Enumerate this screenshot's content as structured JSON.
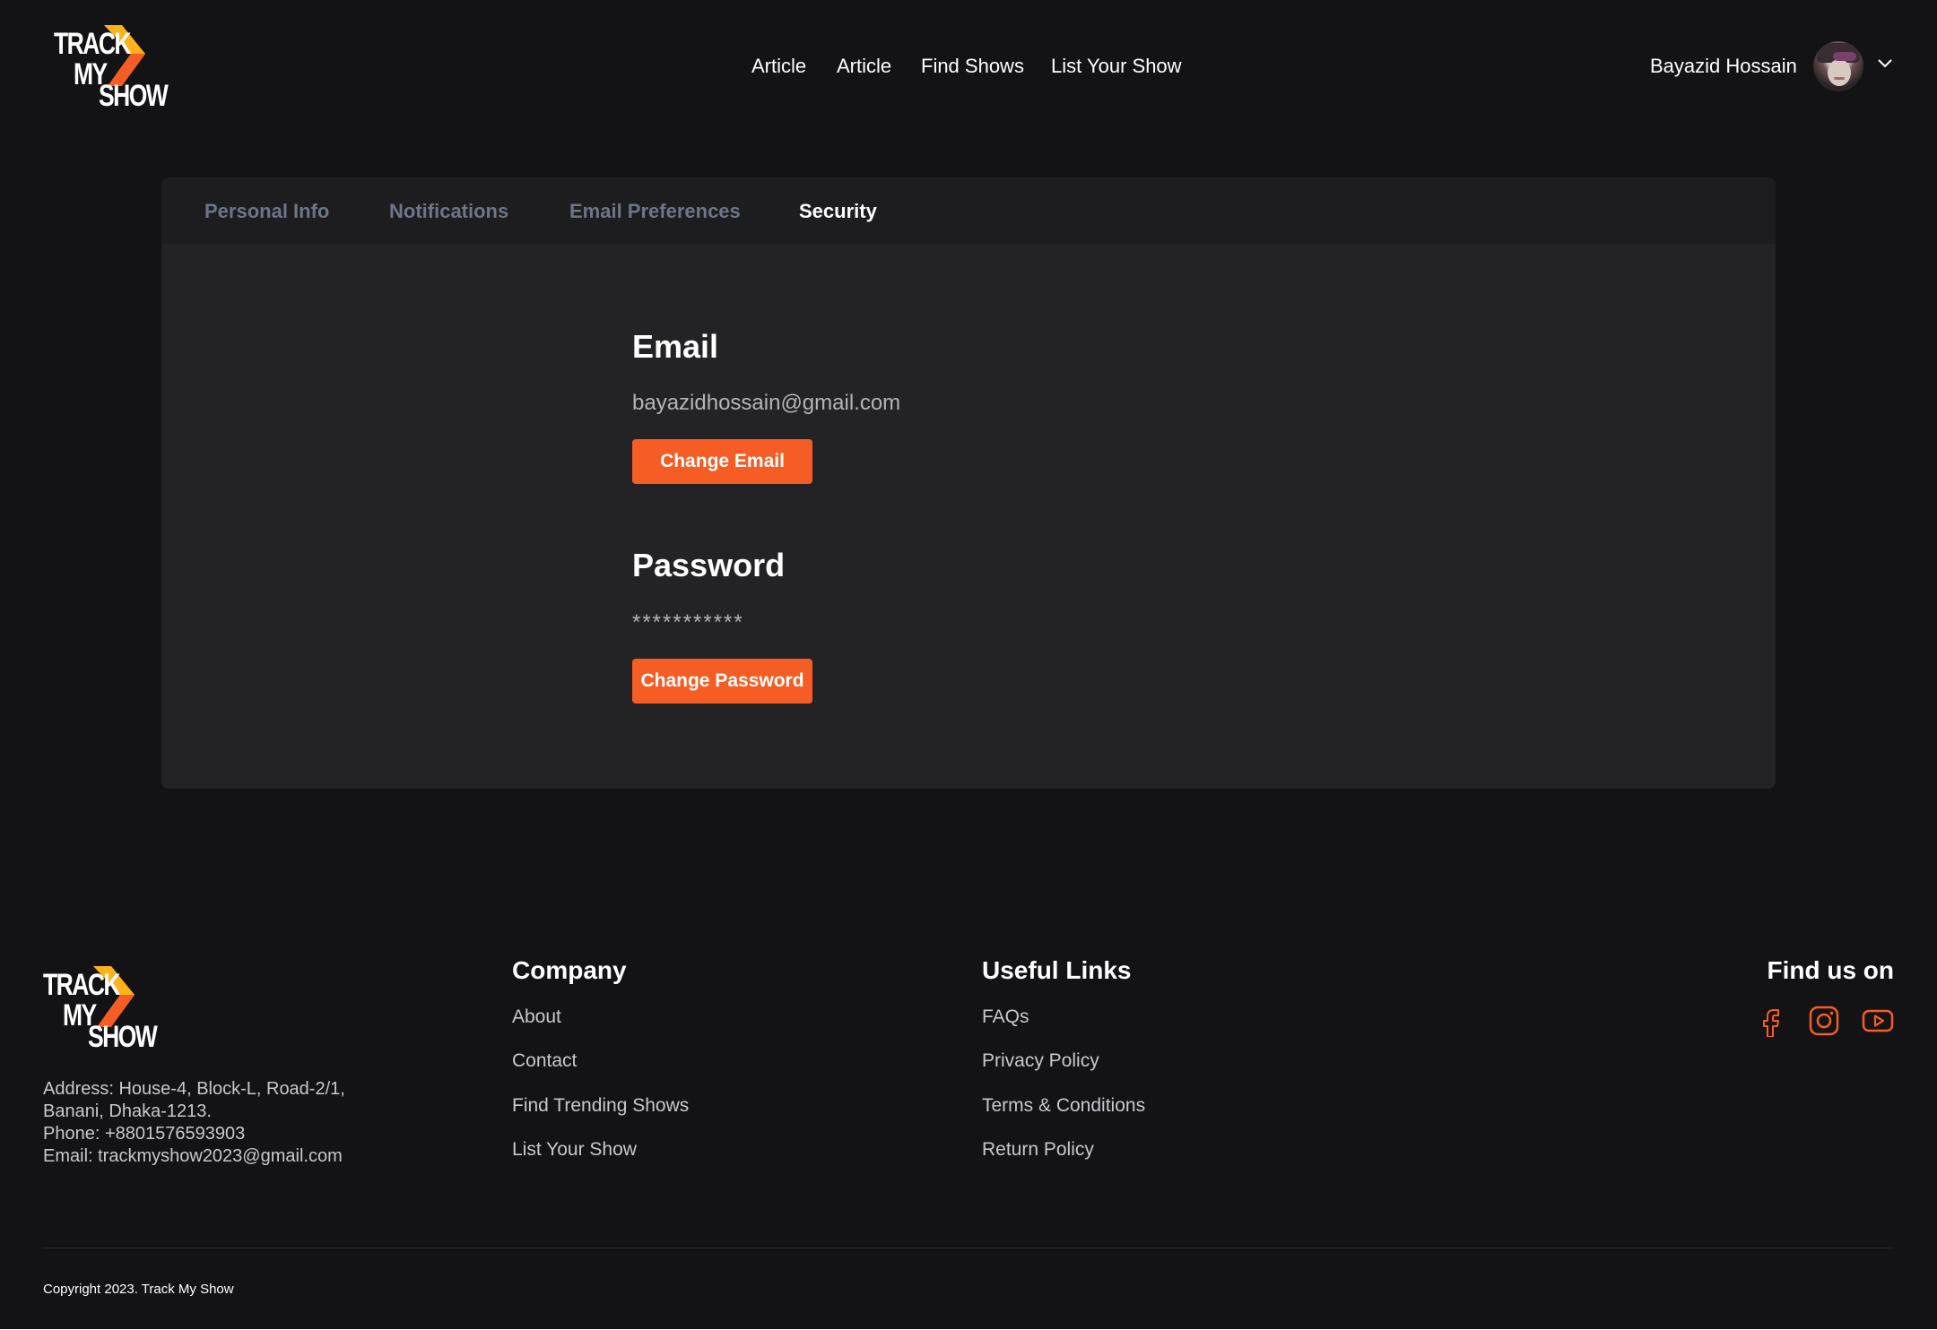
{
  "brand": {
    "logo_lines": [
      "TRACK",
      "MY",
      "SHOW"
    ],
    "accent_color": "#f55d25",
    "accent_secondary": "#ffb21a"
  },
  "nav": {
    "links": [
      "Article",
      "Article",
      "Find Shows",
      "List Your Show"
    ]
  },
  "user": {
    "name": "Bayazid Hossain",
    "avatar_icon": "avatar-photo",
    "menu_icon": "chevron-down-icon"
  },
  "settings": {
    "tabs": [
      "Personal Info",
      "Notifications",
      "Email Preferences",
      "Security"
    ],
    "active_tab": "Security",
    "email": {
      "title": "Email",
      "value": "bayazidhossain@gmail.com",
      "button": "Change Email"
    },
    "password": {
      "title": "Password",
      "value": "***********",
      "button": "Change Password"
    }
  },
  "footer": {
    "address_lines": [
      "Address: House-4, Block-L, Road-2/1,",
      "Banani, Dhaka-1213.",
      "Phone:  +8801576593903",
      "Email:  trackmyshow2023@gmail.com"
    ],
    "company": {
      "title": "Company",
      "links": [
        "About",
        "Contact",
        "Find Trending Shows",
        "List Your Show"
      ]
    },
    "useful_links": {
      "title": "Useful Links",
      "links": [
        "FAQs",
        "Privacy Policy",
        "Terms & Conditions",
        "Return Policy"
      ]
    },
    "social": {
      "title": "Find us on",
      "icons": [
        "facebook-icon",
        "instagram-icon",
        "youtube-icon"
      ]
    },
    "copyright": "Copyright 2023. Track My Show"
  }
}
